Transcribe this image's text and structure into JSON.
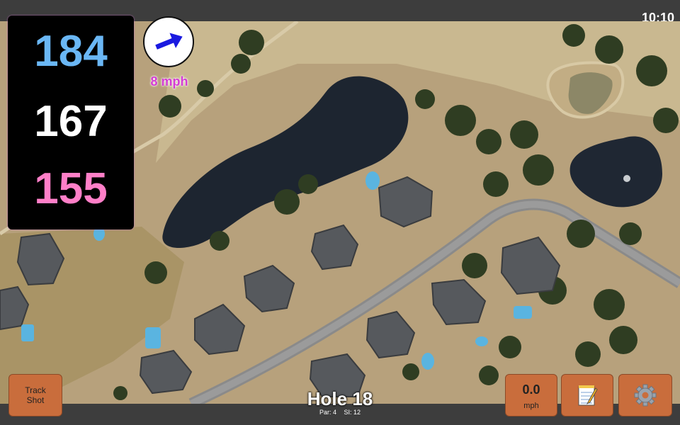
{
  "status": {
    "time": "10:10"
  },
  "distances": {
    "back": "184",
    "middle": "167",
    "front": "155"
  },
  "wind": {
    "speed": "8 mph",
    "icon": "wind-arrow-icon"
  },
  "hole": {
    "title": "Hole 18",
    "par": "Par: 4",
    "si": "SI: 12"
  },
  "buttons": {
    "track_line1": "Track",
    "track_line2": "Shot",
    "speed_value": "0.0",
    "speed_unit": "mph",
    "notes_icon": "notepad-icon",
    "settings_icon": "gear-icon"
  },
  "colors": {
    "back": "#6ab7f5",
    "middle": "#ffffff",
    "front": "#ff7fc8",
    "button": "#c96d3c",
    "bar": "#3d3d3d",
    "wind_text": "#d43bd4",
    "wind_arrow": "#1a1ae0"
  }
}
